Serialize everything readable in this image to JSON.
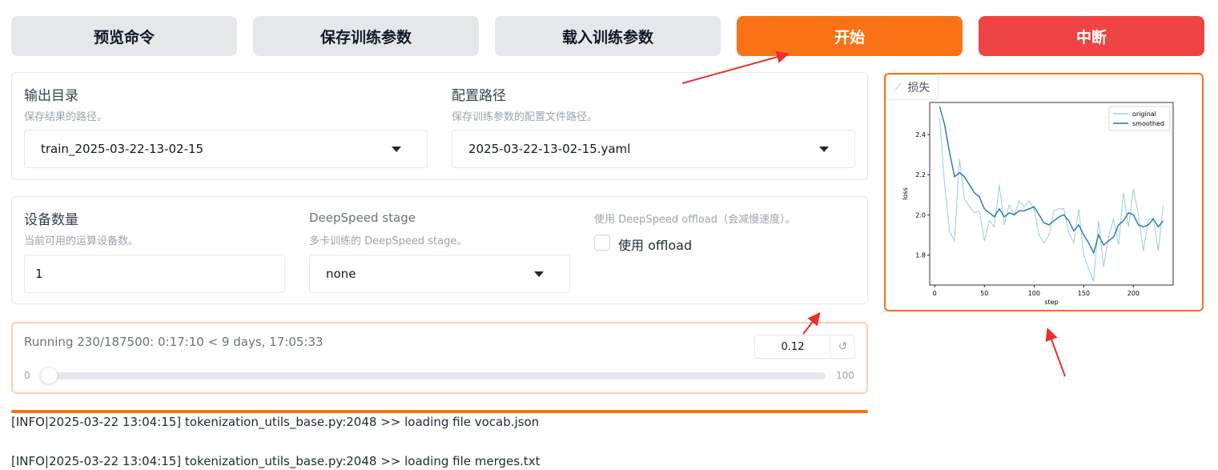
{
  "buttons": {
    "preview": "预览命令",
    "save": "保存训练参数",
    "load": "载入训练参数",
    "start": "开始",
    "abort": "中断"
  },
  "output_dir": {
    "label": "输出目录",
    "info": "保存结果的路径。",
    "value": "train_2025-03-22-13-02-15"
  },
  "config_path": {
    "label": "配置路径",
    "info": "保存训练参数的配置文件路径。",
    "value": "2025-03-22-13-02-15.yaml"
  },
  "device_count": {
    "label": "设备数量",
    "info": "当前可用的运算设备数。",
    "value": "1"
  },
  "ds_stage": {
    "label": "DeepSpeed stage",
    "info": "多卡训练的 DeepSpeed stage。",
    "value": "none"
  },
  "ds_offload": {
    "info": "使用 DeepSpeed offload（会减慢速度）。",
    "label": "使用 offload",
    "checked": false
  },
  "progress": {
    "text": "Running 230/187500: 0:17:10 < 9 days, 17:05:33",
    "value": "0.12",
    "min": "0",
    "max": "100",
    "fraction": 0.0012
  },
  "logs": [
    "[INFO|2025-03-22 13:04:15] tokenization_utils_base.py:2048 >> loading file vocab.json",
    "[INFO|2025-03-22 13:04:15] tokenization_utils_base.py:2048 >> loading file merges.txt"
  ],
  "plot": {
    "tab_label": "损失",
    "chart_data": {
      "type": "line",
      "xlabel": "step",
      "ylabel": "loss",
      "xlim": [
        -5,
        240
      ],
      "ylim": [
        1.65,
        2.56
      ],
      "xticks": [
        0,
        50,
        100,
        150,
        200
      ],
      "yticks": [
        1.8,
        2.0,
        2.2,
        2.4
      ],
      "legend_position": "top-right",
      "series": [
        {
          "name": "original",
          "color": "#a6cee3",
          "x": [
            5,
            10,
            15,
            20,
            25,
            30,
            35,
            40,
            45,
            50,
            55,
            60,
            65,
            70,
            75,
            80,
            85,
            90,
            95,
            100,
            105,
            110,
            115,
            120,
            125,
            130,
            135,
            140,
            145,
            150,
            155,
            160,
            165,
            170,
            175,
            180,
            185,
            190,
            195,
            200,
            205,
            210,
            215,
            220,
            225,
            230
          ],
          "y": [
            2.48,
            2.15,
            1.92,
            1.87,
            2.28,
            2.08,
            2.04,
            2.01,
            2.02,
            1.87,
            1.97,
            1.94,
            2.15,
            1.95,
            2.05,
            2.0,
            2.07,
            2.04,
            2.07,
            2.03,
            1.9,
            1.86,
            1.9,
            2.02,
            2.03,
            2.03,
            1.91,
            1.86,
            2.03,
            1.8,
            1.73,
            1.67,
            1.97,
            1.74,
            1.89,
            1.98,
            1.85,
            2.11,
            1.94,
            2.13,
            2.0,
            1.82,
            1.98,
            1.98,
            1.82,
            2.05
          ]
        },
        {
          "name": "smoothed",
          "color": "#1f78b4",
          "x": [
            5,
            10,
            15,
            20,
            25,
            30,
            35,
            40,
            45,
            50,
            55,
            60,
            65,
            70,
            75,
            80,
            85,
            90,
            95,
            100,
            105,
            110,
            115,
            120,
            125,
            130,
            135,
            140,
            145,
            150,
            155,
            160,
            165,
            170,
            175,
            180,
            185,
            190,
            195,
            200,
            205,
            210,
            215,
            220,
            225,
            230
          ],
          "y": [
            2.54,
            2.45,
            2.31,
            2.19,
            2.21,
            2.19,
            2.15,
            2.11,
            2.09,
            2.03,
            2.01,
            1.99,
            2.03,
            1.99,
            2.01,
            2.0,
            2.02,
            2.02,
            2.03,
            2.04,
            2.0,
            1.96,
            1.95,
            1.97,
            1.99,
            2.0,
            1.97,
            1.92,
            1.95,
            1.9,
            1.86,
            1.81,
            1.9,
            1.85,
            1.87,
            1.89,
            1.95,
            1.97,
            2.01,
            2.0,
            1.95,
            1.94,
            1.95,
            1.98,
            1.94,
            1.97
          ]
        }
      ]
    }
  }
}
